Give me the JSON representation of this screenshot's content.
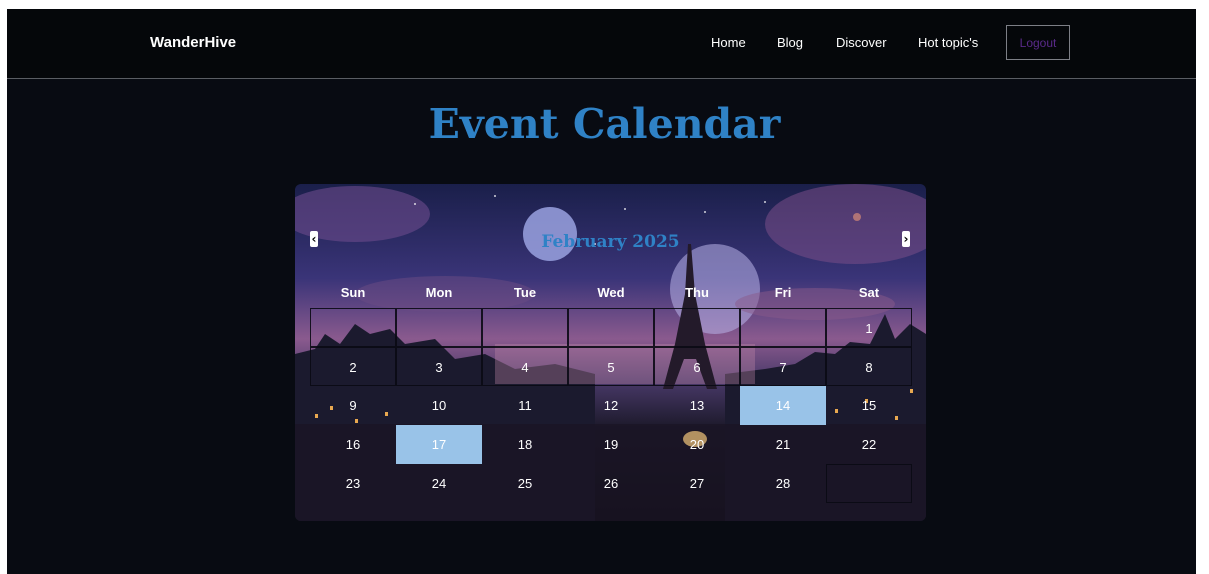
{
  "navbar": {
    "brand": "WanderHive",
    "links": [
      "Home",
      "Blog",
      "Discover",
      "Hot topic's"
    ],
    "logout_label": "Logout"
  },
  "page": {
    "title": "Event Calendar"
  },
  "calendar": {
    "month_label": "February 2025",
    "prev_icon": "chevron-left-icon",
    "next_icon": "chevron-right-icon",
    "weekdays": [
      "Sun",
      "Mon",
      "Tue",
      "Wed",
      "Thu",
      "Fri",
      "Sat"
    ],
    "weeks": [
      [
        "",
        "",
        "",
        "",
        "",
        "",
        "1"
      ],
      [
        "2",
        "3",
        "4",
        "5",
        "6",
        "7",
        "8"
      ],
      [
        "9",
        "10",
        "11",
        "12",
        "13",
        "14",
        "15"
      ],
      [
        "16",
        "17",
        "18",
        "19",
        "20",
        "21",
        "22"
      ],
      [
        "23",
        "24",
        "25",
        "26",
        "27",
        "28",
        ""
      ]
    ],
    "highlighted_days": [
      "14",
      "17"
    ],
    "highlight_color": "#99c3e8",
    "background": "night-paris-eiffel-tower-illustration"
  }
}
